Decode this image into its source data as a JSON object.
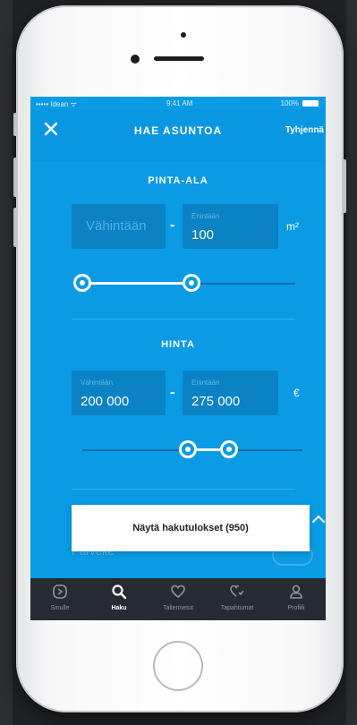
{
  "status_bar": {
    "carrier": "••••• Idean ᯤ",
    "time": "9:41 AM",
    "battery": "100%"
  },
  "header": {
    "title": "HAE ASUNTOA",
    "clear_label": "Tyhjennä",
    "close_icon": "close-icon"
  },
  "area": {
    "title": "PINTA-ALA",
    "min_placeholder": "Vähintään",
    "max_label": "Enintään",
    "max_value": "100",
    "separator": "-",
    "unit": "m²"
  },
  "price": {
    "title": "HINTA",
    "min_label": "Vähintään",
    "min_value": "200 000",
    "max_label": "Enintään",
    "max_value": "275 000",
    "separator": "-",
    "unit": "€"
  },
  "behind_button_label": "Parveke",
  "results_button": "Näytä hakutulokset (950)",
  "tabs": [
    {
      "label": "Sinulle",
      "icon": "sinulle-icon",
      "active": false
    },
    {
      "label": "Haku",
      "icon": "search-icon",
      "active": true
    },
    {
      "label": "Tallennetut",
      "icon": "heart-icon",
      "active": false
    },
    {
      "label": "Tapahtumat",
      "icon": "event-heart-icon",
      "active": false
    },
    {
      "label": "Profiili",
      "icon": "profile-icon",
      "active": false
    }
  ],
  "colors": {
    "screen_bg": "#0b9be4",
    "field_bg": "#0a82c4",
    "tabbar_bg": "#262a33"
  }
}
